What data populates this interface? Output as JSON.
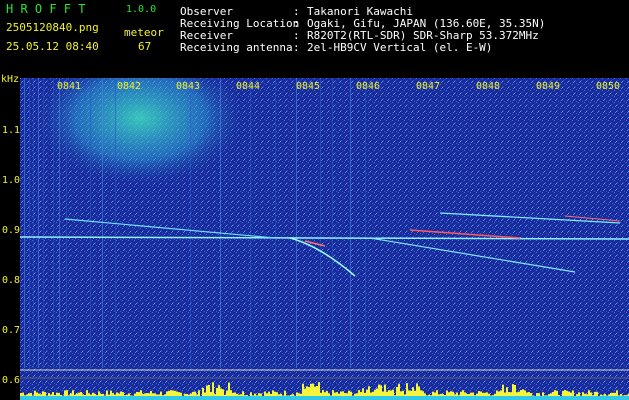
{
  "app": {
    "logo": "H R O F F T",
    "version": "1.0.0",
    "filename": "2505120840.png",
    "timestamp": "25.05.12 08:40",
    "meteor_label": "meteor",
    "meteor_count": "67"
  },
  "info": {
    "labels": [
      "Observer",
      "Receiving Location",
      "Receiver",
      "Receiving antenna"
    ],
    "separators": [
      ":",
      ":",
      ":",
      ":"
    ],
    "values": [
      "Takanori Kawachi",
      "Ogaki, Gifu, JAPAN (136.60E, 35.35N)",
      "R820T2(RTL-SDR) SDR-Sharp 53.372MHz",
      "2el-HB9CV Vertical (el. E-W)"
    ]
  },
  "spectrogram": {
    "y_unit": "kHz",
    "y_ticks": [
      "1.1",
      "1.0",
      "0.9",
      "0.8",
      "0.7",
      "0.6"
    ],
    "time_ticks": [
      "0841",
      "0842",
      "0843",
      "0844",
      "0845",
      "0846",
      "0847",
      "0848",
      "0849",
      "0850"
    ],
    "colors": {
      "background": "#1a2a9a",
      "noise": "#2f6bd8",
      "hot": "#3fe0c0",
      "signal": "#9ff",
      "meteor": "#ff5a5a",
      "baseline": "#ffff00"
    }
  }
}
